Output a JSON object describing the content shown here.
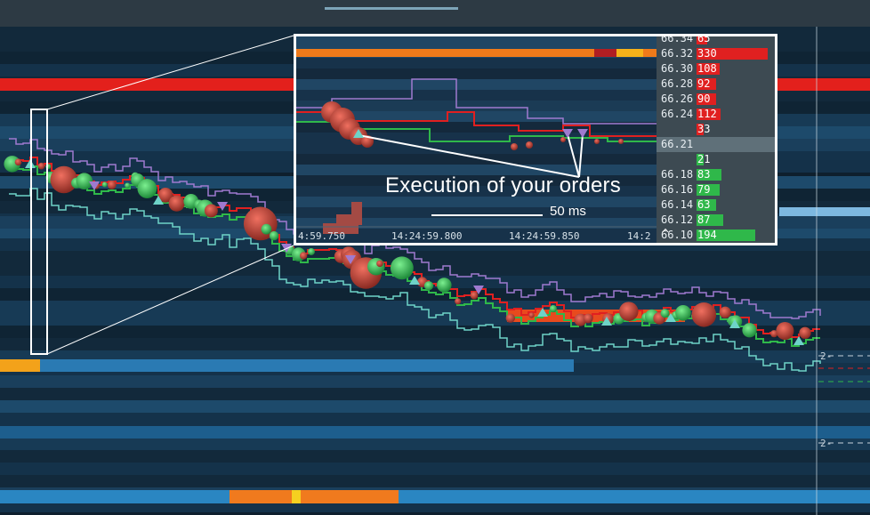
{
  "zoom": {
    "caption": "Execution of your orders",
    "scale_label": "50 ms",
    "timestamps": [
      "4:59.750",
      "14:24:59.800",
      "14:24:59.850",
      "14:2"
    ],
    "collapse_icon": "chevron-up-icon",
    "order_book": [
      {
        "price": "66.34",
        "size": "65",
        "side": "ask",
        "level": 0.15
      },
      {
        "price": "66.32",
        "size": "330",
        "side": "ask",
        "level": 1.0
      },
      {
        "price": "66.30",
        "size": "108",
        "side": "ask",
        "level": 0.33
      },
      {
        "price": "66.28",
        "size": "92",
        "side": "ask",
        "level": 0.28
      },
      {
        "price": "66.26",
        "size": "90",
        "side": "ask",
        "level": 0.27
      },
      {
        "price": "66.24",
        "size": "112",
        "side": "ask",
        "level": 0.34
      },
      {
        "price": "",
        "size": "33",
        "side": "ask",
        "level": 0.1
      },
      {
        "price": "66.21",
        "size": "",
        "side": "current",
        "level": 0
      },
      {
        "price": "",
        "size": "21",
        "side": "bid",
        "level": 0.1
      },
      {
        "price": "66.18",
        "size": "83",
        "side": "bid",
        "level": 0.35
      },
      {
        "price": "66.16",
        "size": "79",
        "side": "bid",
        "level": 0.33
      },
      {
        "price": "66.14",
        "size": "63",
        "side": "bid",
        "level": 0.27
      },
      {
        "price": "66.12",
        "size": "87",
        "side": "bid",
        "level": 0.37
      },
      {
        "price": "66.10",
        "size": "194",
        "side": "bid",
        "level": 0.82
      }
    ]
  },
  "right_axis": {
    "labels": [
      "2-",
      "2-"
    ]
  },
  "colors": {
    "ask": "#e02020",
    "bid": "#2fb84a",
    "order_marker": "#9f7ad0",
    "exec_marker": "#6ed3c8",
    "trade_bubble_sell": "#b8433a",
    "trade_bubble_buy": "#3cba66",
    "large_liquidity": "#ff7a1a"
  }
}
